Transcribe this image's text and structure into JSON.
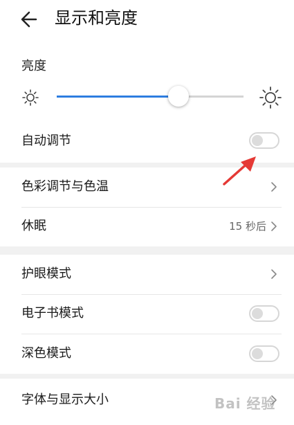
{
  "header": {
    "title": "显示和亮度"
  },
  "brightness": {
    "label": "亮度",
    "level_percent": 65
  },
  "rows": {
    "auto_adjust": {
      "label": "自动调节",
      "enabled": false
    },
    "color": {
      "label": "色彩调节与色温"
    },
    "sleep": {
      "label": "休眠",
      "value": "15 秒后"
    },
    "eye_comfort": {
      "label": "护眼模式"
    },
    "ebook": {
      "label": "电子书模式",
      "enabled": false
    },
    "dark": {
      "label": "深色模式",
      "enabled": false
    },
    "font": {
      "label": "字体与显示大小"
    }
  },
  "icons": {
    "back": "back-arrow-icon",
    "sun_small": "sun-small-icon",
    "sun_large": "sun-large-icon",
    "chevron": "chevron-right-icon"
  },
  "colors": {
    "accent": "#2d7de0",
    "annotation_arrow": "#e53935"
  },
  "watermark": {
    "text": "Bai 经验"
  }
}
